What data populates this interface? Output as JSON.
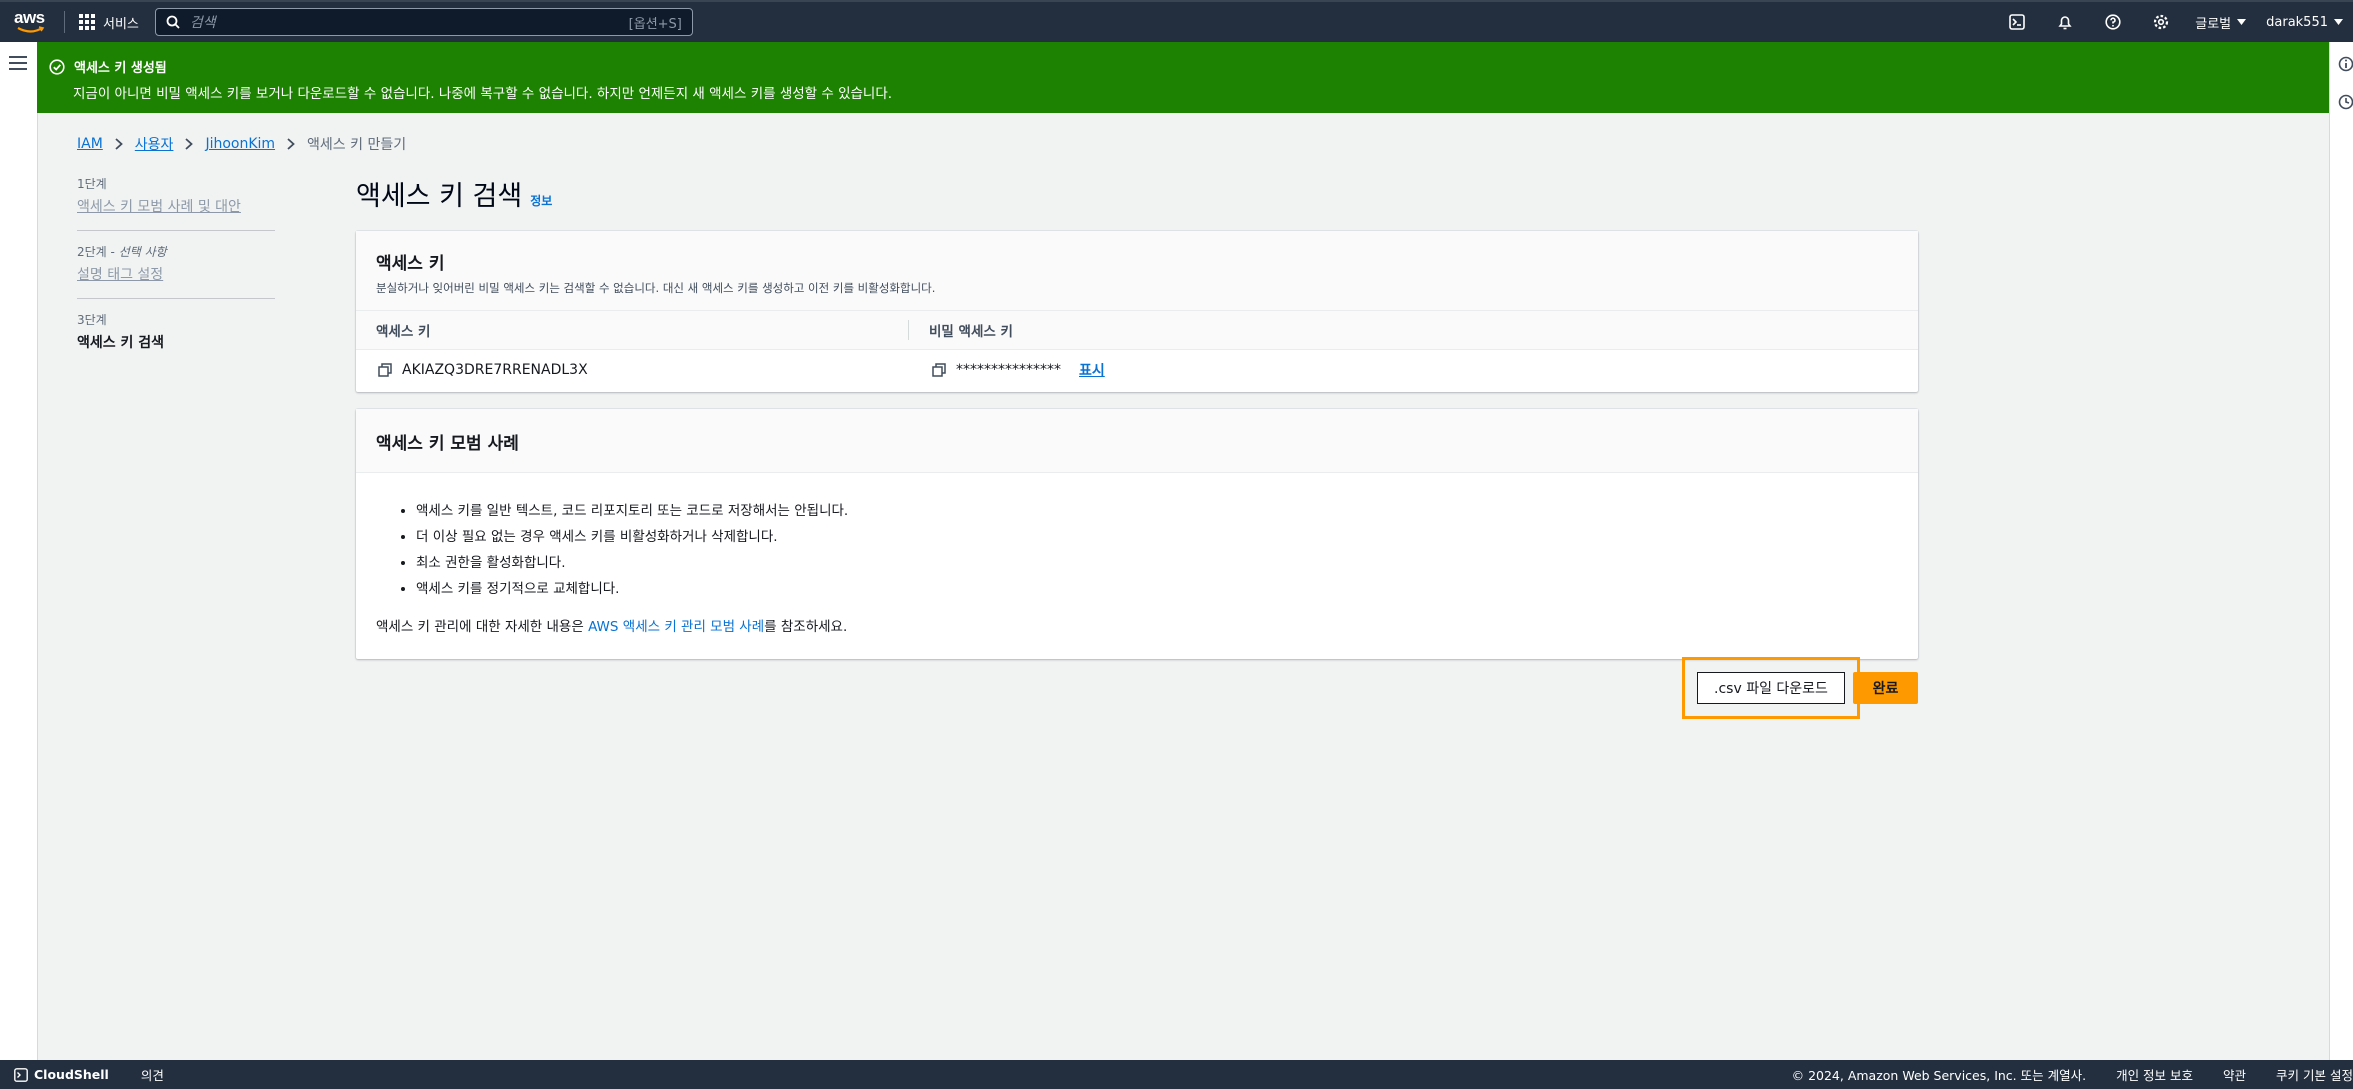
{
  "topnav": {
    "logo": "aws",
    "services_label": "서비스",
    "search_placeholder": "검색",
    "search_shortcut": "[옵션+S]",
    "region": "글로벌",
    "account": "darak551"
  },
  "flash": {
    "title": "액세스 키 생성됨",
    "message": "지금이 아니면 비밀 액세스 키를 보거나 다운로드할 수 없습니다. 나중에 복구할 수 없습니다. 하지만 언제든지 새 액세스 키를 생성할 수 있습니다."
  },
  "breadcrumb": [
    "IAM",
    "사용자",
    "JihoonKim",
    "액세스 키 만들기"
  ],
  "steps": [
    {
      "num": "1단계",
      "title": "액세스 키 모범 사례 및 대안"
    },
    {
      "num": "2단계",
      "optional": "선택 사항",
      "title": "설명 태그 설정"
    },
    {
      "num": "3단계",
      "title": "액세스 키 검색"
    }
  ],
  "page": {
    "title": "액세스 키 검색",
    "info": "정보"
  },
  "access_key_card": {
    "title": "액세스 키",
    "description": "분실하거나 잊어버린 비밀 액세스 키는 검색할 수 없습니다. 대신 새 액세스 키를 생성하고 이전 키를 비활성화합니다.",
    "col_access_key": "액세스 키",
    "col_secret_key": "비밀 액세스 키",
    "access_key_value": "AKIAZQ3DRE7RRENADL3X",
    "secret_key_masked": "***************",
    "show_label": "표시"
  },
  "best_practices": {
    "title": "액세스 키 모범 사례",
    "items": [
      "액세스 키를 일반 텍스트, 코드 리포지토리 또는 코드로 저장해서는 안됩니다.",
      "더 이상 필요 없는 경우 액세스 키를 비활성화하거나 삭제합니다.",
      "최소 권한을 활성화합니다.",
      "액세스 키를 정기적으로 교체합니다."
    ],
    "note_prefix": "액세스 키 관리에 대한 자세한 내용은 ",
    "note_link": "AWS 액세스 키 관리 모범 사례",
    "note_suffix": "를 참조하세요."
  },
  "actions": {
    "download_csv": ".csv 파일 다운로드",
    "done": "완료"
  },
  "footer": {
    "cloudshell": "CloudShell",
    "feedback": "의견",
    "copyright": "© 2024, Amazon Web Services, Inc. 또는 계열사.",
    "privacy": "개인 정보 보호",
    "terms": "약관",
    "cookies": "쿠키 기본 설정"
  }
}
